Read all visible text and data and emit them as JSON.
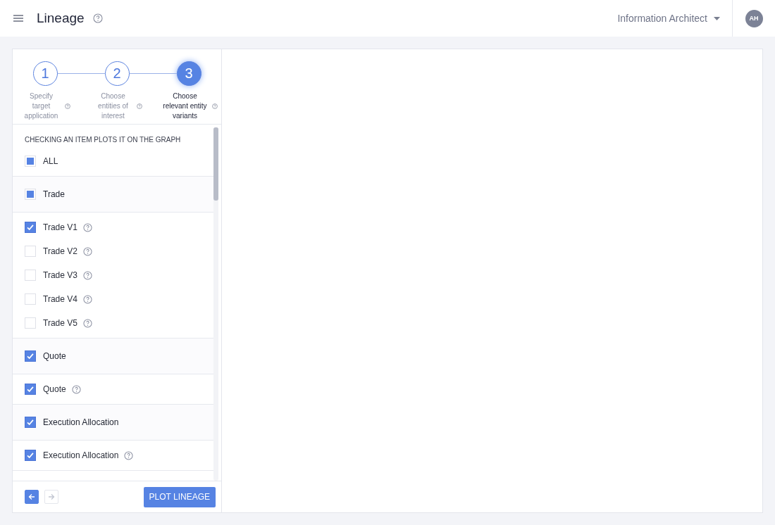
{
  "header": {
    "title": "Lineage",
    "role": "Information Architect",
    "avatar": "AH"
  },
  "steps": [
    {
      "number": "1",
      "label": "Specify target application",
      "active": false
    },
    {
      "number": "2",
      "label": "Choose entities of interest",
      "active": false
    },
    {
      "number": "3",
      "label": "Choose relevant entity variants",
      "active": true
    }
  ],
  "instruction": "CHECKING AN ITEM PLOTS IT ON THE GRAPH",
  "all": {
    "label": "ALL",
    "checked": false,
    "indeterminate": true
  },
  "groups": [
    {
      "label": "Trade",
      "checked": false,
      "indeterminate": true,
      "variants": [
        {
          "label": "Trade V1",
          "checked": true
        },
        {
          "label": "Trade V2",
          "checked": false
        },
        {
          "label": "Trade V3",
          "checked": false
        },
        {
          "label": "Trade V4",
          "checked": false
        },
        {
          "label": "Trade V5",
          "checked": false
        }
      ]
    },
    {
      "label": "Quote",
      "checked": true,
      "indeterminate": false,
      "variants": [
        {
          "label": "Quote",
          "checked": true
        }
      ]
    },
    {
      "label": "Execution Allocation",
      "checked": true,
      "indeterminate": false,
      "variants": [
        {
          "label": "Execution Allocation",
          "checked": true
        }
      ]
    }
  ],
  "footer": {
    "back_enabled": true,
    "next_enabled": false,
    "button": "PLOT LINEAGE"
  }
}
